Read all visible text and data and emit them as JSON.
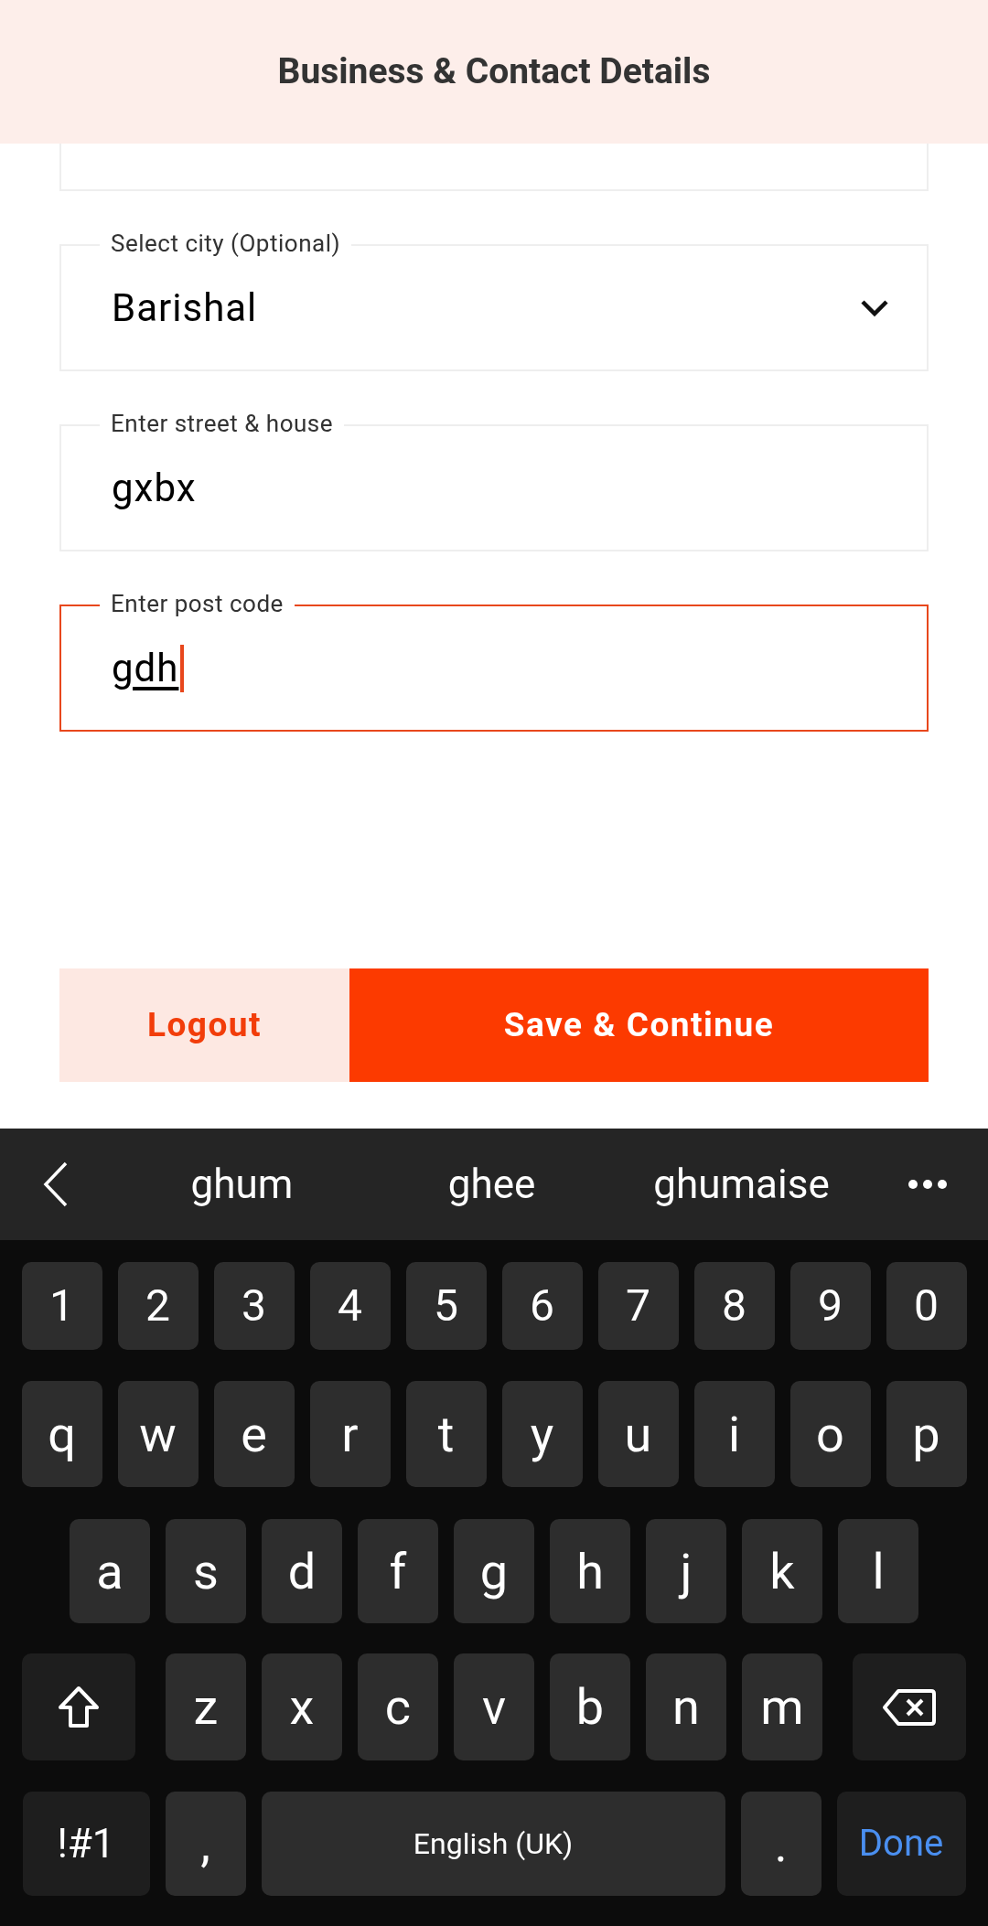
{
  "header": {
    "title": "Business & Contact Details"
  },
  "fields": [
    {
      "kind": "partial",
      "focused": false
    },
    {
      "kind": "select",
      "label": "Select city (Optional)",
      "value": "Barishal",
      "focused": false
    },
    {
      "kind": "text",
      "label": "Enter street & house",
      "value": "gxbx",
      "focused": false
    },
    {
      "kind": "text",
      "label": "Enter post code",
      "value": "gdh",
      "focused": true
    }
  ],
  "buttons": [
    {
      "kind": "secondary",
      "label": "Logout"
    },
    {
      "kind": "primary",
      "label": "Save & Continue"
    }
  ],
  "keyboard": {
    "suggestions": [
      "ghum",
      "ghee",
      "ghumaise"
    ],
    "rows": [
      {
        "keys": [
          {
            "kind": "char",
            "label": "1"
          },
          {
            "kind": "char",
            "label": "2"
          },
          {
            "kind": "char",
            "label": "3"
          },
          {
            "kind": "char",
            "label": "4"
          },
          {
            "kind": "char",
            "label": "5"
          },
          {
            "kind": "char",
            "label": "6"
          },
          {
            "kind": "char",
            "label": "7"
          },
          {
            "kind": "char",
            "label": "8"
          },
          {
            "kind": "char",
            "label": "9"
          },
          {
            "kind": "char",
            "label": "0"
          }
        ]
      },
      {
        "keys": [
          {
            "kind": "char",
            "label": "q"
          },
          {
            "kind": "char",
            "label": "w"
          },
          {
            "kind": "char",
            "label": "e"
          },
          {
            "kind": "char",
            "label": "r"
          },
          {
            "kind": "char",
            "label": "t"
          },
          {
            "kind": "char",
            "label": "y"
          },
          {
            "kind": "char",
            "label": "u"
          },
          {
            "kind": "char",
            "label": "i"
          },
          {
            "kind": "char",
            "label": "o"
          },
          {
            "kind": "char",
            "label": "p"
          }
        ]
      },
      {
        "keys": [
          {
            "kind": "char",
            "label": "a"
          },
          {
            "kind": "char",
            "label": "s"
          },
          {
            "kind": "char",
            "label": "d"
          },
          {
            "kind": "char",
            "label": "f"
          },
          {
            "kind": "char",
            "label": "g"
          },
          {
            "kind": "char",
            "label": "h"
          },
          {
            "kind": "char",
            "label": "j"
          },
          {
            "kind": "char",
            "label": "k"
          },
          {
            "kind": "char",
            "label": "l"
          }
        ]
      },
      {
        "keys": [
          {
            "kind": "shift"
          },
          {
            "kind": "char",
            "label": "z"
          },
          {
            "kind": "char",
            "label": "x"
          },
          {
            "kind": "char",
            "label": "c"
          },
          {
            "kind": "char",
            "label": "v"
          },
          {
            "kind": "char",
            "label": "b"
          },
          {
            "kind": "char",
            "label": "n"
          },
          {
            "kind": "char",
            "label": "m"
          },
          {
            "kind": "backspace"
          }
        ]
      },
      {
        "keys": [
          {
            "kind": "symbols",
            "label": "!#1"
          },
          {
            "kind": "char",
            "label": ","
          },
          {
            "kind": "space",
            "label": "English (UK)"
          },
          {
            "kind": "char",
            "label": "."
          },
          {
            "kind": "done",
            "label": "Done"
          }
        ]
      }
    ]
  }
}
